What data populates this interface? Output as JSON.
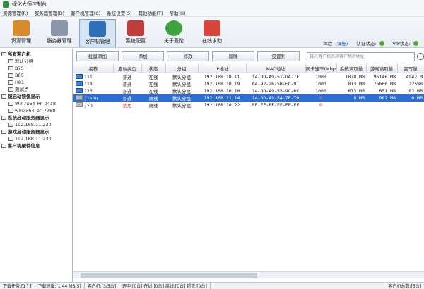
{
  "window": {
    "title": "绿化大师控制台"
  },
  "menu": [
    "资源管理(R)",
    "服务器管理(D)",
    "客户机管理(C)",
    "系统设置(S)",
    "其他功能(T)",
    "帮助(H)"
  ],
  "toolbar": [
    {
      "label": "资源管理",
      "color": "#d98a2b"
    },
    {
      "label": "服务器管理",
      "color": "#8a96a8"
    },
    {
      "label": "客户机管理",
      "color": "#2e6fb8"
    },
    {
      "label": "系统配置",
      "color": "#c23b3b"
    },
    {
      "label": "关于蓋伦",
      "color": "#3da33d"
    },
    {
      "label": "在线求助",
      "color": "#d9453a"
    }
  ],
  "status": {
    "level": "体验",
    "detail": "(详细)",
    "auth_label": "认证状态:",
    "vip_label": "VIP状态:"
  },
  "tree": [
    "所有客户机",
    "默认分组",
    "B75",
    "B85",
    "H81",
    "测试点",
    "镜启动镜像显示",
    "Win7x64_Pr_0418",
    "win7x64_pr_7788",
    "系统启动服务器显示",
    "192.168.11.230",
    "游戏启动服务器显示",
    "192.168.11.230",
    "客户机硬件信息"
  ],
  "buttons": [
    "批量添加",
    "添加",
    "修改",
    "删除",
    "设置列"
  ],
  "search": {
    "placeholder": "输入客户机名称客户机IP地址"
  },
  "table": {
    "headers": [
      "名称",
      "启动类型",
      "状态",
      "分组",
      "IP地址",
      "MAC地址",
      "网卡速率(Mbps)",
      "系统读取量",
      "游戏读取量",
      "回写量"
    ],
    "rows": [
      [
        "111",
        "普通",
        "在线",
        "默认分组",
        "192.168.10.11",
        "14-DD-A9-51-DA-7E",
        "1000",
        "1878 MB",
        "95146 MB",
        "4942 M"
      ],
      [
        "118",
        "普通",
        "在线",
        "默认分组",
        "192.168.10.19",
        "04-92-26-5B-ED-91",
        "1000",
        "813 MB",
        "75686 MB",
        "22598"
      ],
      [
        "123",
        "普通",
        "在线",
        "默认分组",
        "192.168.10.10",
        "14-DD-A9-55-9C-6C",
        "1000",
        "673 MB",
        "651 MB",
        "82 MB"
      ],
      [
        "jishu",
        "普通",
        "离线",
        "默认分组",
        "192.168.11.14",
        "14-DD-A9-54-7E-70",
        "0",
        "0 MB",
        "962 MB",
        "0 MB"
      ],
      [
        "jsq",
        "禁用",
        "离线",
        "默认分组",
        "192.168.10.22",
        "FF-FF-FF-FF-FF-FF",
        "0",
        "",
        "",
        ""
      ]
    ]
  },
  "statusbar": [
    "下载任务:[1个]",
    "下载速度:[1.44 MB/S]",
    "客户机:[3/5台]",
    "选中:[0台] 在线:[0台] 离线:[0台] 超管:[0台]",
    "客户机总数:[5台]"
  ]
}
